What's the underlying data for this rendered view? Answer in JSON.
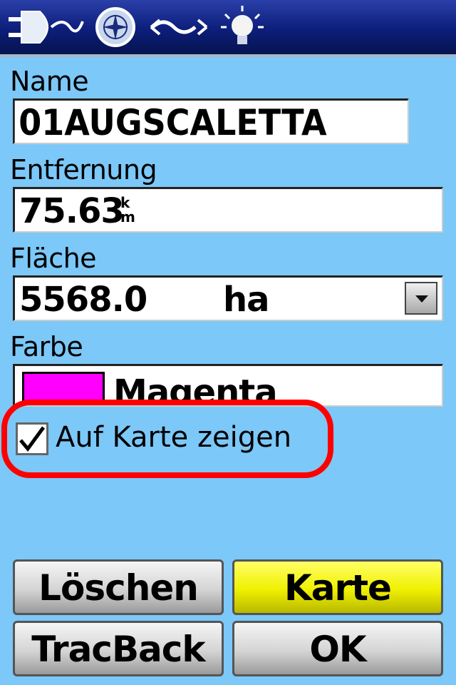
{
  "toolbar": {
    "icons": [
      "power-plug-icon",
      "compass-icon",
      "track-icon",
      "light-bulb-icon"
    ]
  },
  "form": {
    "name_label": "Name",
    "name_value": "01AUGSCALETTA",
    "distance_label": "Entfernung",
    "distance_value": "75.63",
    "distance_unit_top": "k",
    "distance_unit_bottom": "m",
    "area_label": "Fläche",
    "area_value": "5568.0",
    "area_unit": "ha",
    "color_label": "Farbe",
    "color_value": "Magenta",
    "color_swatch": "#ff00ff",
    "show_on_map_label": "Auf Karte zeigen",
    "show_on_map_checked": true
  },
  "buttons": {
    "delete": "Löschen",
    "map": "Karte",
    "tracback": "TracBack",
    "ok": "OK"
  },
  "colors": {
    "background": "#7cc8f8",
    "highlight": "#ff0000",
    "selected_button": "#f0f000"
  }
}
